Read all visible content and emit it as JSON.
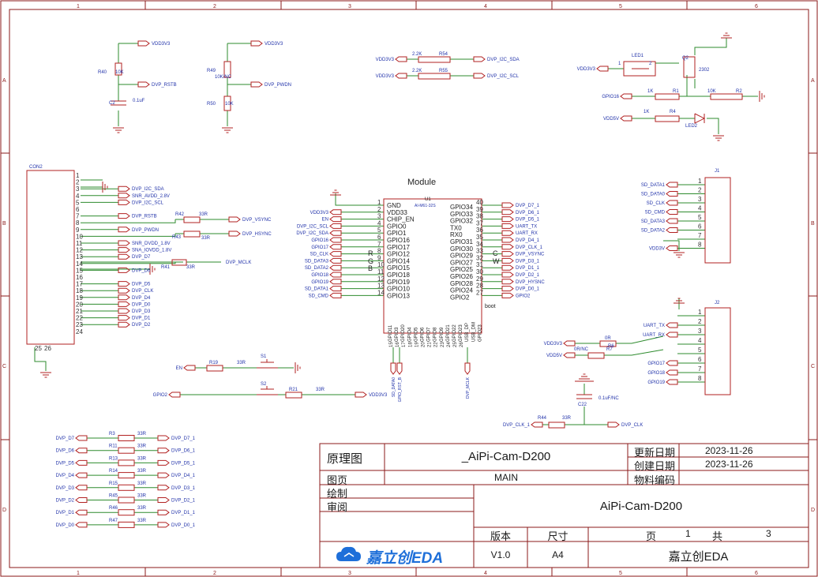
{
  "border": {
    "col_labels": [
      "1",
      "2",
      "3",
      "4",
      "5",
      "6"
    ],
    "row_labels": [
      "A",
      "B",
      "C",
      "D"
    ]
  },
  "power_labels": {
    "vdd3v3": "VDD3V3",
    "vdd5v": "VDD5V"
  },
  "top_left": {
    "r40": {
      "ref": "R40",
      "val": "10K"
    },
    "c2": {
      "ref": "C2",
      "val": "0.1uF"
    },
    "dvp_rstb": "DVP_RSTB",
    "r49": {
      "ref": "R49",
      "val": "10K/NC"
    },
    "r50": {
      "ref": "R50",
      "val": "10K"
    },
    "dvp_pwdn": "DVP_PWDN"
  },
  "top_mid": {
    "r54": {
      "ref": "R54",
      "val": "2.2K"
    },
    "r55": {
      "ref": "R55",
      "val": "2.2K"
    },
    "net_sda": "DVP_I2C_SDA",
    "net_scl": "DVP_I2C_SCL"
  },
  "top_right": {
    "led1": "LED1",
    "q2": "Q2",
    "q2_part": "2302",
    "pin1": "1",
    "pin2": "2",
    "r1": {
      "ref": "R1",
      "val": "1K"
    },
    "r2": {
      "ref": "R2",
      "val": "10K"
    },
    "r4": {
      "ref": "R4",
      "val": "1K"
    },
    "led2": "LED2",
    "gpio16": "GPIO16"
  },
  "con2": {
    "ref": "CON2",
    "pins": [
      "1",
      "2",
      "3",
      "4",
      "5",
      "6",
      "7",
      "8",
      "9",
      "10",
      "11",
      "12",
      "13",
      "14",
      "15",
      "16",
      "17",
      "18",
      "19",
      "20",
      "21",
      "22",
      "23",
      "24"
    ],
    "nets": [
      "",
      "",
      "DVP_I2C_SDA",
      "SNR_AVDD_2.8V",
      "DVP_I2C_SCL",
      "",
      "DVP_RSTB",
      "DVP_VSYNC",
      "DVP_PWDN",
      "DVP_HSYNC",
      "SNR_DVDD_1.8V",
      "SNA_IOVDD_1.8V",
      "DVP_D7",
      "DVP_MCLK",
      "DVP_D6",
      "",
      "DVP_D5",
      "DVP_CLK",
      "DVP_D4",
      "DVP_D0",
      "DVP_D3",
      "DVP_D1",
      "DVP_D2",
      ""
    ],
    "r42": {
      "ref": "R42",
      "val": "33R"
    },
    "r43": {
      "ref": "R43",
      "val": "33R"
    },
    "r41": {
      "ref": "R41",
      "val": "33R"
    },
    "bottom_pins": [
      "25",
      "26"
    ]
  },
  "module": {
    "title": "Module",
    "ref": "U1",
    "part": "AI-M61-32S",
    "left_pins": [
      {
        "n": "1",
        "name": "GND",
        "net": ""
      },
      {
        "n": "2",
        "name": "VDD33",
        "net": "VDD3V3"
      },
      {
        "n": "3",
        "name": "CHIP_EN",
        "net": "EN"
      },
      {
        "n": "4",
        "name": "GPIO0",
        "net": "DVP_I2C_SCL"
      },
      {
        "n": "5",
        "name": "GPIO1",
        "net": "DVP_I2C_SDA"
      },
      {
        "n": "6",
        "name": "GPIO16",
        "net": "GPIO16"
      },
      {
        "n": "7",
        "name": "GPIO17",
        "net": "GPIO17"
      },
      {
        "n": "8",
        "name": "GPIO12",
        "net": "SD_CLK"
      },
      {
        "n": "9",
        "name": "GPIO14",
        "net": "SD_DATA3"
      },
      {
        "n": "10",
        "name": "GPIO15",
        "net": "SD_DATA2"
      },
      {
        "n": "11",
        "name": "GPIO18",
        "net": "GPIO18"
      },
      {
        "n": "12",
        "name": "GPIO19",
        "net": "GPIO19"
      },
      {
        "n": "13",
        "name": "GPIO10",
        "net": "SD_DATA1"
      },
      {
        "n": "14",
        "name": "GPIO13",
        "net": "SD_CMD"
      }
    ],
    "right_pins": [
      {
        "n": "40",
        "name": "GPIO34",
        "net": "DVP_D7_1"
      },
      {
        "n": "39",
        "name": "GPIO33",
        "net": "DVP_D6_1"
      },
      {
        "n": "38",
        "name": "GPIO32",
        "net": "DVP_D5_1"
      },
      {
        "n": "37",
        "name": "TX0",
        "net": "UART_TX"
      },
      {
        "n": "36",
        "name": "RX0",
        "net": "UART_RX"
      },
      {
        "n": "35",
        "name": "GPIO31",
        "net": "DVP_D4_1"
      },
      {
        "n": "34",
        "name": "GPIO30",
        "net": "DVP_CLK_1"
      },
      {
        "n": "33",
        "name": "GPIO29",
        "net": "DVP_VSYNC"
      },
      {
        "n": "32",
        "name": "GPIO27",
        "net": "DVP_D3_1"
      },
      {
        "n": "31",
        "name": "GPIO25",
        "net": "DVP_D1_1"
      },
      {
        "n": "30",
        "name": "GPIO26",
        "net": "DVP_D2_1"
      },
      {
        "n": "29",
        "name": "GPIO28",
        "net": "DVP_HYSNC"
      },
      {
        "n": "28",
        "name": "GPIO24",
        "net": "DVP_D0_1"
      },
      {
        "n": "27",
        "name": "GPIO2",
        "net": "GPIO2"
      }
    ],
    "bottom_pins": [
      "GPIO11",
      "GPIO3",
      "GPIO20",
      "GPIO4",
      "GPIO5",
      "GPIO6",
      "GPIO7",
      "GPIO8",
      "GPIO9",
      "GPIO21",
      "GPIO22",
      "GPIO23",
      "USB_DP",
      "USB_DM",
      "GPIO23"
    ],
    "bottom_nums": [
      "15",
      "16",
      "17",
      "18",
      "19",
      "20",
      "21",
      "22",
      "23",
      "24",
      "25",
      "26"
    ],
    "bottom_nets": [
      "SD_DATA0",
      "GPIO_RST_B",
      "DVP_MCLK"
    ],
    "side_marks": {
      "r": "R",
      "g": "G",
      "b": "B",
      "c": "C",
      "w": "W",
      "boot": "boot"
    }
  },
  "j1": {
    "ref": "J1",
    "pins": [
      "1",
      "2",
      "3",
      "4",
      "5",
      "6",
      "7",
      "8"
    ],
    "nets": [
      "SD_DATA1",
      "SD_DATA0",
      "SD_CLK",
      "SD_CMD",
      "SD_DATA3",
      "SD_DATA2",
      "",
      "VDD3V"
    ]
  },
  "j2": {
    "ref": "J2",
    "pins": [
      "1",
      "2",
      "3",
      "4",
      "5",
      "6",
      "7",
      "8"
    ],
    "nets": [
      "",
      "UART_TX",
      "UART_RX",
      "",
      "",
      "GPIO17",
      "GPIO18",
      "GPIO19"
    ]
  },
  "mid_right": {
    "r6": {
      "ref": "R6",
      "val": "0R"
    },
    "r7": {
      "ref": "R7",
      "val": "0R/NC"
    },
    "c22": {
      "ref": "C22",
      "val": "0.1uF/NC"
    },
    "r44": {
      "ref": "R44",
      "val": "33R"
    },
    "dvp_clk_1": "DVP_CLK_1",
    "dvp_clk": "DVP_CLK"
  },
  "buttons": {
    "s1": "S1",
    "s2": "S2",
    "r19": {
      "ref": "R19",
      "val": "33R"
    },
    "r21": {
      "ref": "R21",
      "val": "33R"
    },
    "en": "EN",
    "gpio2": "GPIO2"
  },
  "resistor_array": [
    {
      "ref": "R3",
      "val": "33R",
      "left": "DVP_D7",
      "right": "DVP_D7_1"
    },
    {
      "ref": "R11",
      "val": "33R",
      "left": "DVP_D6",
      "right": "DVP_D6_1"
    },
    {
      "ref": "R13",
      "val": "33R",
      "left": "DVP_D5",
      "right": "DVP_D5_1"
    },
    {
      "ref": "R14",
      "val": "33R",
      "left": "DVP_D4",
      "right": "DVP_D4_1"
    },
    {
      "ref": "R15",
      "val": "33R",
      "left": "DVP_D3",
      "right": "DVP_D3_1"
    },
    {
      "ref": "R45",
      "val": "33R",
      "left": "DVP_D2",
      "right": "DVP_D2_1"
    },
    {
      "ref": "R46",
      "val": "33R",
      "left": "DVP_D1",
      "right": "DVP_D1_1"
    },
    {
      "ref": "R47",
      "val": "33R",
      "left": "DVP_D0",
      "right": "DVP_D0_1"
    }
  ],
  "title_block": {
    "schematic_label": "原理图",
    "schematic_value": "_AiPi-Cam-D200",
    "updated_label": "更新日期",
    "updated_value": "2023-11-26",
    "created_label": "创建日期",
    "created_value": "2023-11-26",
    "page_label": "图页",
    "page_value": "MAIN",
    "material_label": "物料编码",
    "draw_label": "绘制",
    "review_label": "审阅",
    "project_title": "AiPi-Cam-D200",
    "version_label": "版本",
    "size_label": "尺寸",
    "page_of_label": "页",
    "total_label": "共",
    "version_value": "V1.0",
    "size_value": "A4",
    "page_num": "1",
    "page_total": "3",
    "logo_text": "嘉立创EDA",
    "company": "嘉立创EDA"
  },
  "colors": {
    "wire": "#2e8b2e",
    "part": "#b22222",
    "frame": "#8b1a1a",
    "text": "#2233aa",
    "pin": "#333333"
  }
}
